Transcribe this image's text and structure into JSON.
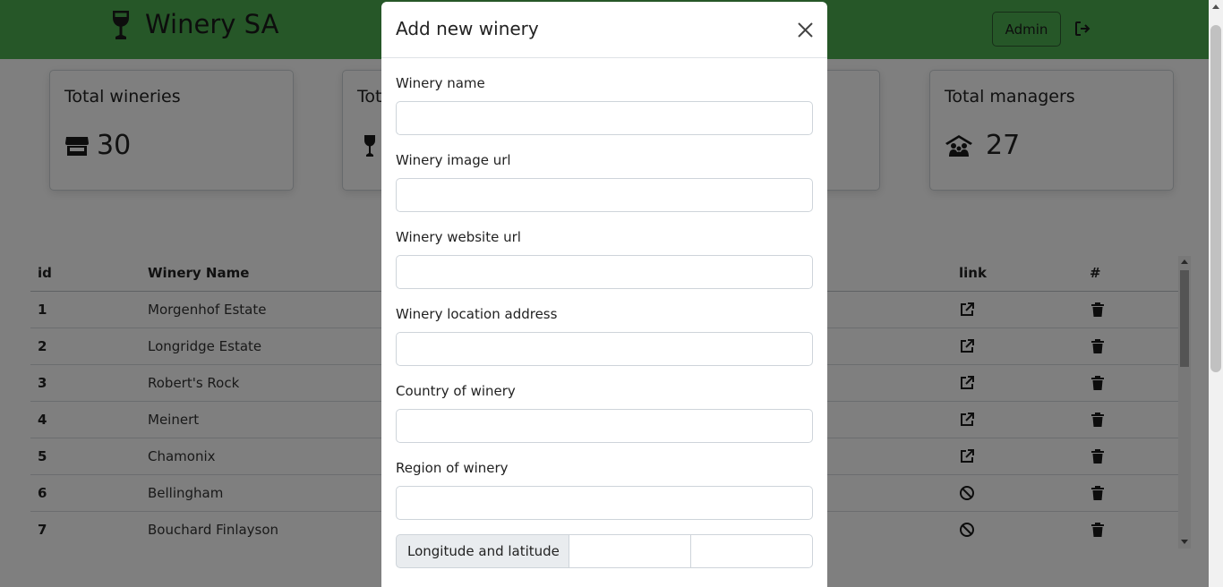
{
  "header": {
    "brand": "Winery SA",
    "admin_label": "Admin"
  },
  "stats": [
    {
      "title": "Total wineries",
      "value": "30",
      "icon": "store-icon"
    },
    {
      "title": "Tot",
      "value": "",
      "icon": "wine-glass-icon"
    },
    {
      "title": "",
      "value": "",
      "icon": ""
    },
    {
      "title": "Total managers",
      "value": "27",
      "icon": "people-roof-icon"
    }
  ],
  "table": {
    "headers": {
      "id": "id",
      "name": "Winery Name",
      "link": "link",
      "actions": "#"
    },
    "rows": [
      {
        "id": "1",
        "name": "Morgenhof Estate",
        "link": "external-link-icon"
      },
      {
        "id": "2",
        "name": "Longridge Estate",
        "link": "external-link-icon"
      },
      {
        "id": "3",
        "name": "Robert's Rock",
        "link": "external-link-icon"
      },
      {
        "id": "4",
        "name": "Meinert",
        "link": "external-link-icon"
      },
      {
        "id": "5",
        "name": "Chamonix",
        "link": "external-link-icon"
      },
      {
        "id": "6",
        "name": "Bellingham",
        "link": "ban-icon"
      },
      {
        "id": "7",
        "name": "Bouchard Finlayson",
        "link": "ban-icon"
      }
    ]
  },
  "modal": {
    "title": "Add new winery",
    "fields": [
      {
        "label": "Winery name",
        "value": ""
      },
      {
        "label": "Winery image url",
        "value": ""
      },
      {
        "label": "Winery website url",
        "value": ""
      },
      {
        "label": "Winery location address",
        "value": ""
      },
      {
        "label": "Country of winery",
        "value": ""
      },
      {
        "label": "Region of winery",
        "value": ""
      }
    ],
    "coordinates_label": "Longitude and latitude"
  },
  "colors": {
    "navbar": "#4caf50",
    "backdrop": "rgba(0,0,0,0.5)"
  }
}
